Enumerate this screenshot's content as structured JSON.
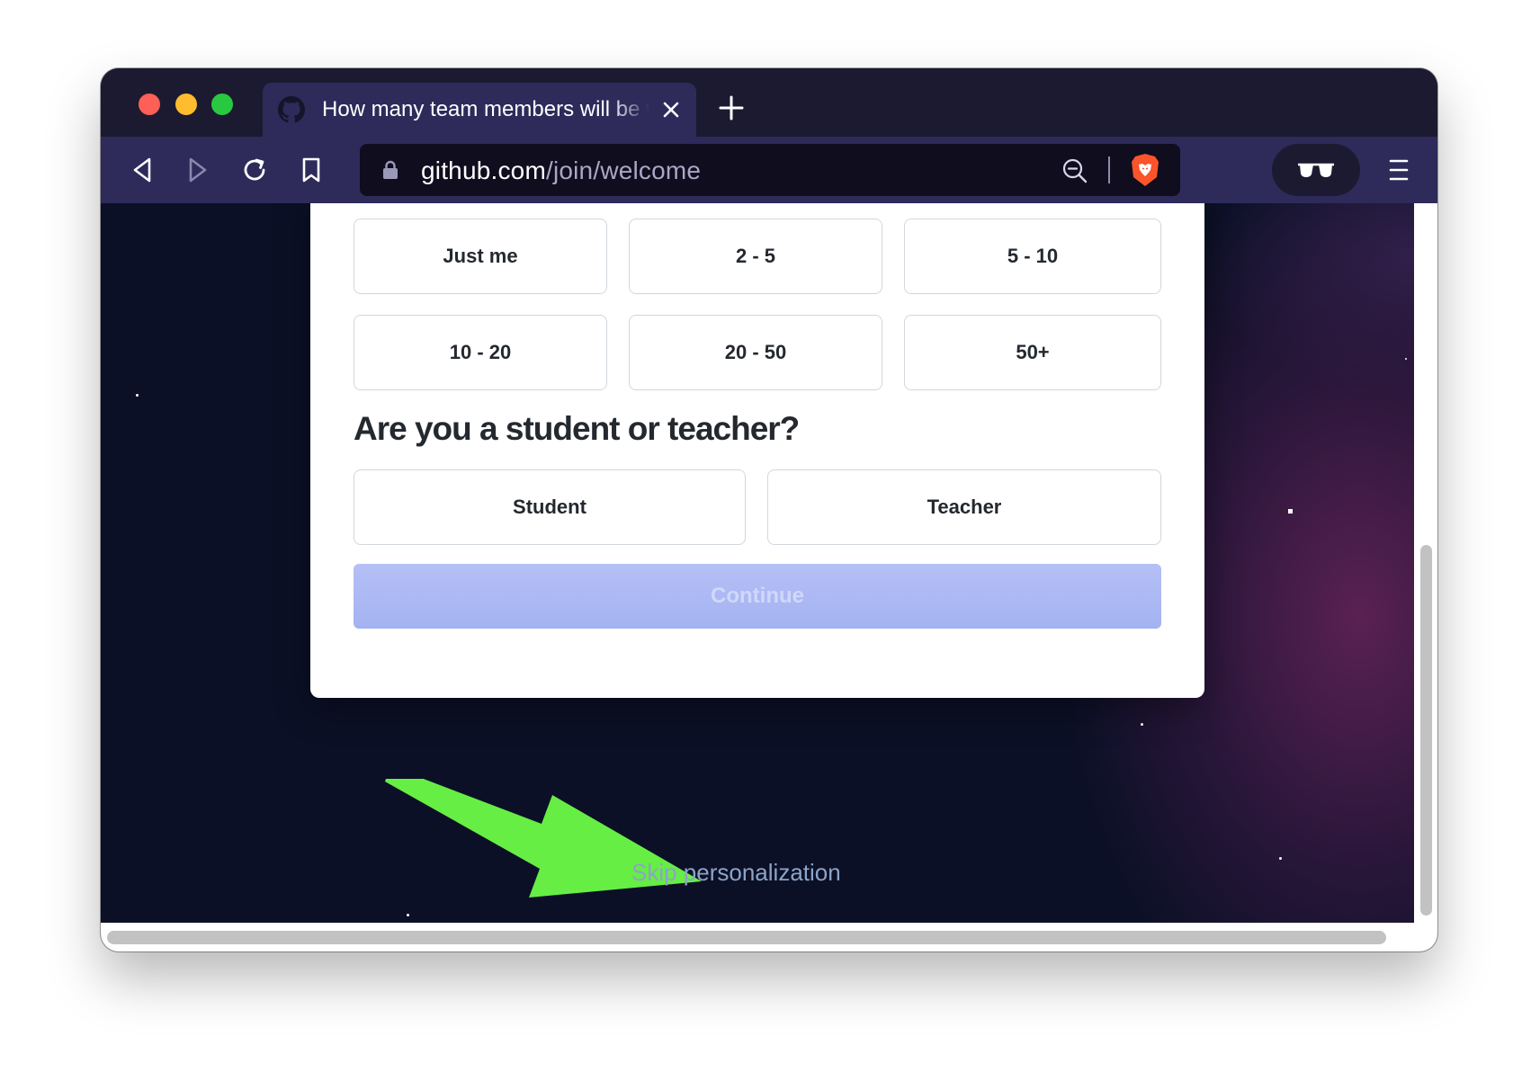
{
  "tab": {
    "title": "How many team members will be working with you?",
    "favicon": "github-icon",
    "close_icon": "close-icon",
    "new_tab_icon": "plus-icon"
  },
  "toolbar": {
    "back_icon": "back-icon",
    "forward_icon": "forward-icon",
    "reload_icon": "reload-icon",
    "bookmark_icon": "bookmark-icon",
    "url_host": "github.com",
    "url_path": "/join/welcome",
    "lock_icon": "lock-icon",
    "zoom_icon": "zoom-out-icon",
    "shield_icon": "brave-shield-icon",
    "private_icon": "sunglasses-icon",
    "menu_icon": "hamburger-menu-icon"
  },
  "team_size": {
    "options": [
      "Just me",
      "2 - 5",
      "5 - 10",
      "10 - 20",
      "20 - 50",
      "50+"
    ]
  },
  "role": {
    "question": "Are you a student or teacher?",
    "options": [
      "Student",
      "Teacher"
    ]
  },
  "continue_label": "Continue",
  "skip_label": "Skip personalization",
  "annotation_arrow": "green-arrow",
  "colors": {
    "tab_bg": "#2e2a5a",
    "url_bar_bg": "#0f0d1e",
    "page_bg": "#0b1026",
    "continue_bg": "#aab6f3",
    "skip_link": "#8da3c8",
    "arrow": "#66ee44"
  }
}
